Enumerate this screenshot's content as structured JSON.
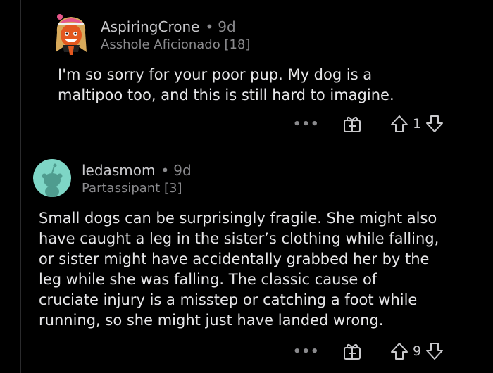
{
  "comments": [
    {
      "username": "AspiringCrone",
      "age": "9d",
      "flair": "Asshole Aficionado [18]",
      "avatar": "aspiringcrone-avatar",
      "body_lines": [
        "I'm so sorry for your poor pup.  My dog is a",
        "maltipoo too, and this is still hard to imagine."
      ],
      "more_label": "•••",
      "score": "1"
    },
    {
      "username": "ledasmom",
      "age": "9d",
      "flair": "Partassipant [3]",
      "avatar": "ledasmom-avatar",
      "body_lines": [
        "Small dogs can be surprisingly fragile. She might also",
        "have caught a leg in the sister’s clothing while falling,",
        "or sister might have accidentally grabbed her by the",
        "leg while she was falling. The classic cause of",
        "cruciate injury is a misstep or catching a foot while",
        "running, so she might just have landed wrong."
      ],
      "more_label": "•••",
      "score": "9"
    }
  ],
  "separator_dot": "•",
  "colors": {
    "background": "#000000",
    "text": "#e6e6e8",
    "muted": "#8a8a8d",
    "avatar_teal": "#7ed6c6"
  }
}
